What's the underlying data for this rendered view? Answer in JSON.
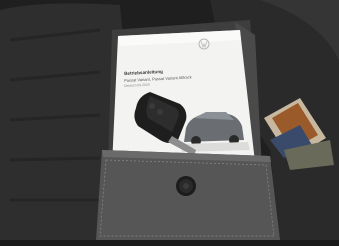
{
  "scene": {
    "subject": "VW owner's manual wallet with car key on a car seat",
    "manual": {
      "title": "Betriebsanleitung",
      "subtitle": "Passat Variant, Passat Variant Alltrack",
      "note": "Deutsch 03.2020"
    },
    "colors": {
      "seat": "#2b2b2b",
      "wallet": "#3f3f3f",
      "booklet": "#f4f4f2",
      "accent": "#d9d7d2"
    },
    "icons": [
      "vw-logo-icon",
      "car-key-icon",
      "snap-button-icon"
    ]
  }
}
